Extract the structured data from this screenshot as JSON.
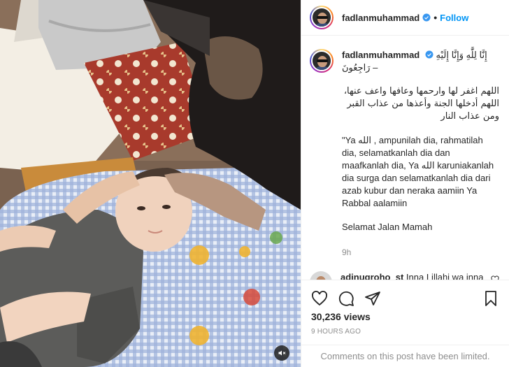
{
  "post": {
    "author": "fadlanmuhammad",
    "follow_label": "Follow",
    "separator": "•",
    "caption": {
      "title_arabic": "إِنَّا لِلَّٰهِ وَإِنَّا إِلَيْهِ رَاجِعُونَ –",
      "dua_line1": "اللهم اغفر لها وارحمها وعافها واعف عنها،",
      "dua_line2": "اللهم أدخلها الجنة وأعذها من عذاب القبر",
      "dua_line3": "ومن عذاب النار",
      "indonesian": "\"Ya الله , ampunilah dia, rahmatilah dia, selamatkanlah dia dan maafkanlah dia, Ya الله karuniakanlah dia surga dan selamatkanlah dia dari azab kubur dan neraka aamiin Ya Rabbal aalamiin",
      "closing": "Selamat Jalan Mamah",
      "age": "9h"
    },
    "comments": [
      {
        "user": "adinugroho_st",
        "text": "Inna Lillahi wa inna ilayhi raji'un"
      }
    ],
    "views": "30,236 views",
    "posted": "9 HOURS AGO",
    "comments_status": "Comments on this post have been limited.",
    "icons": {
      "verified": "verified-badge-icon",
      "like": "heart-icon",
      "comment": "comment-icon",
      "share": "share-icon",
      "save": "bookmark-icon",
      "mute": "muted-speaker-icon"
    },
    "colors": {
      "link": "#0095f6",
      "verified": "#3897f0",
      "muted_text": "#8e8e8e"
    }
  }
}
